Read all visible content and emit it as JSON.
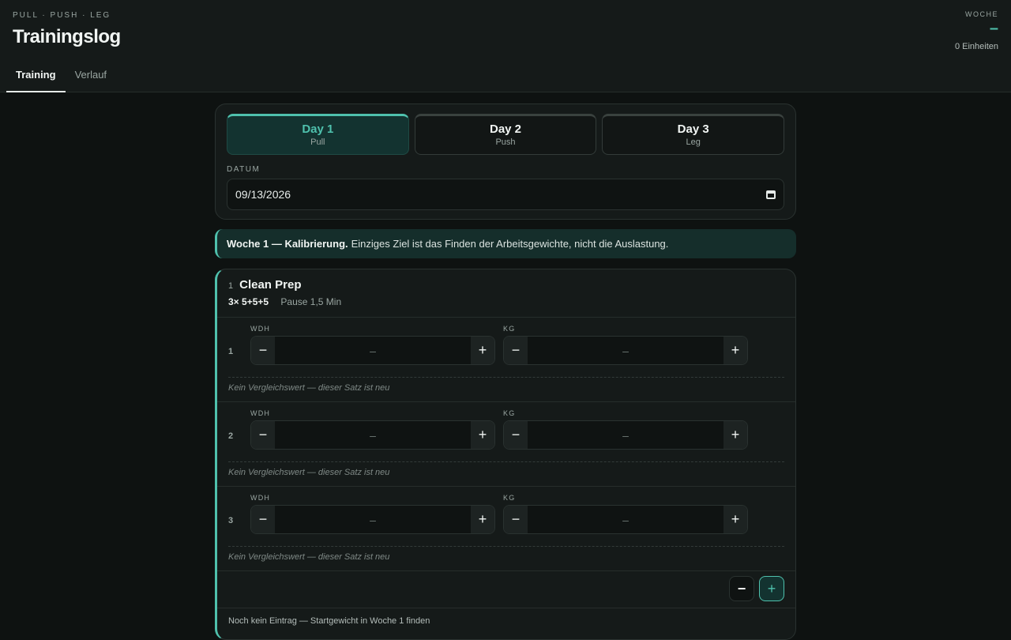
{
  "header": {
    "eyebrow": "PULL · PUSH · LEG",
    "title": "Trainingslog",
    "week_label": "WOCHE",
    "week_value": "–",
    "units": "0 Einheiten"
  },
  "tabs": [
    {
      "label": "Training",
      "active": true
    },
    {
      "label": "Verlauf",
      "active": false
    }
  ],
  "days": [
    {
      "name": "Day 1",
      "sub": "Pull",
      "active": true
    },
    {
      "name": "Day 2",
      "sub": "Push",
      "active": false
    },
    {
      "name": "Day 3",
      "sub": "Leg",
      "active": false
    }
  ],
  "date": {
    "label": "DATUM",
    "value": "09/13/2026"
  },
  "banner": {
    "bold": "Woche 1 — Kalibrierung.",
    "text": "Einziges Ziel ist das Finden der Arbeitsgewichte, nicht die Auslastung."
  },
  "exercise": {
    "number": "1",
    "name": "Clean Prep",
    "scheme": "3× 5+5+5",
    "rest": "Pause 1,5 Min",
    "sets": [
      {
        "num": "1",
        "wdh_label": "WDH",
        "kg_label": "KG",
        "wdh_value": "–",
        "kg_value": "–",
        "note": "Kein Vergleichswert — dieser Satz ist neu"
      },
      {
        "num": "2",
        "wdh_label": "WDH",
        "kg_label": "KG",
        "wdh_value": "–",
        "kg_value": "–",
        "note": "Kein Vergleichswert — dieser Satz ist neu"
      },
      {
        "num": "3",
        "wdh_label": "WDH",
        "kg_label": "KG",
        "wdh_value": "–",
        "kg_value": "–",
        "note": "Kein Vergleichswert — dieser Satz ist neu"
      }
    ],
    "minus_symbol": "−",
    "plus_symbol": "+",
    "footer": "Noch kein Eintrag — Startgewicht in Woche 1 finden"
  },
  "colors": {
    "accent": "#4fc1ad",
    "background": "#0e1211",
    "surface": "#151a19"
  },
  "icons": {
    "date": "calendar-icon"
  }
}
